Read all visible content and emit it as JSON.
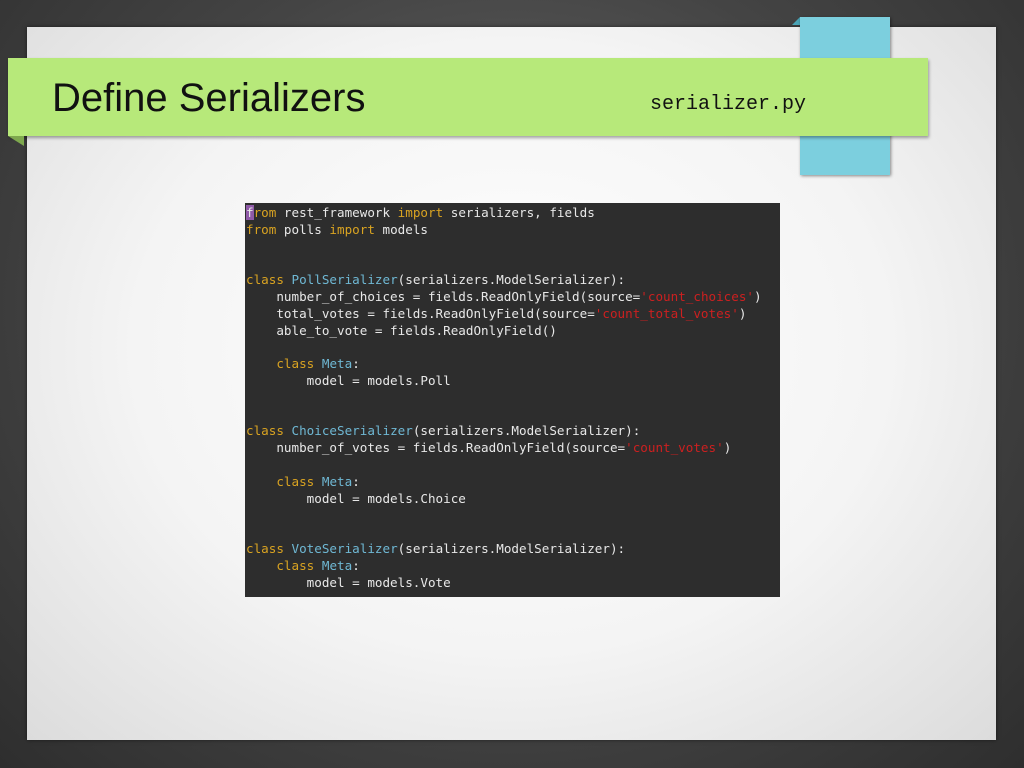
{
  "slide": {
    "title": "Define Serializers",
    "filename": "serializer.py"
  },
  "colors": {
    "banner": "#b7e97a",
    "tab": "#7ccfde",
    "code_bg": "#2d2d2d",
    "keyword": "#d9a321",
    "class_name": "#6fb8d4",
    "string": "#cc2020",
    "text": "#e8e8e8"
  },
  "code": {
    "lines": [
      [
        {
          "t": "f",
          "c": "kw cursor"
        },
        {
          "t": "rom",
          "c": "kw"
        },
        {
          "t": " rest_framework "
        },
        {
          "t": "import",
          "c": "kw"
        },
        {
          "t": " serializers, fields"
        }
      ],
      [
        {
          "t": "from",
          "c": "kw"
        },
        {
          "t": " polls "
        },
        {
          "t": "import",
          "c": "kw"
        },
        {
          "t": " models"
        }
      ],
      [],
      [],
      [
        {
          "t": "class",
          "c": "kw"
        },
        {
          "t": " "
        },
        {
          "t": "PollSerializer",
          "c": "cls"
        },
        {
          "t": "(serializers.ModelSerializer):"
        }
      ],
      [
        {
          "t": "    number_of_choices = fields.ReadOnlyField(source="
        },
        {
          "t": "'count_choices'",
          "c": "str"
        },
        {
          "t": ")"
        }
      ],
      [
        {
          "t": "    total_votes = fields.ReadOnlyField(source="
        },
        {
          "t": "'count_total_votes'",
          "c": "str"
        },
        {
          "t": ")"
        }
      ],
      [
        {
          "t": "    able_to_vote = fields.ReadOnlyField()"
        }
      ],
      [],
      [
        {
          "t": "    "
        },
        {
          "t": "class",
          "c": "kw"
        },
        {
          "t": " "
        },
        {
          "t": "Meta",
          "c": "cls"
        },
        {
          "t": ":"
        }
      ],
      [
        {
          "t": "        model = models.Poll"
        }
      ],
      [],
      [],
      [
        {
          "t": "class",
          "c": "kw"
        },
        {
          "t": " "
        },
        {
          "t": "ChoiceSerializer",
          "c": "cls"
        },
        {
          "t": "(serializers.ModelSerializer):"
        }
      ],
      [
        {
          "t": "    number_of_votes = fields.ReadOnlyField(source="
        },
        {
          "t": "'count_votes'",
          "c": "str"
        },
        {
          "t": ")"
        }
      ],
      [],
      [
        {
          "t": "    "
        },
        {
          "t": "class",
          "c": "kw"
        },
        {
          "t": " "
        },
        {
          "t": "Meta",
          "c": "cls"
        },
        {
          "t": ":"
        }
      ],
      [
        {
          "t": "        model = models.Choice"
        }
      ],
      [],
      [],
      [
        {
          "t": "class",
          "c": "kw"
        },
        {
          "t": " "
        },
        {
          "t": "VoteSerializer",
          "c": "cls"
        },
        {
          "t": "(serializers.ModelSerializer):"
        }
      ],
      [
        {
          "t": "    "
        },
        {
          "t": "class",
          "c": "kw"
        },
        {
          "t": " "
        },
        {
          "t": "Meta",
          "c": "cls"
        },
        {
          "t": ":"
        }
      ],
      [
        {
          "t": "        model = models.Vote"
        }
      ]
    ]
  }
}
